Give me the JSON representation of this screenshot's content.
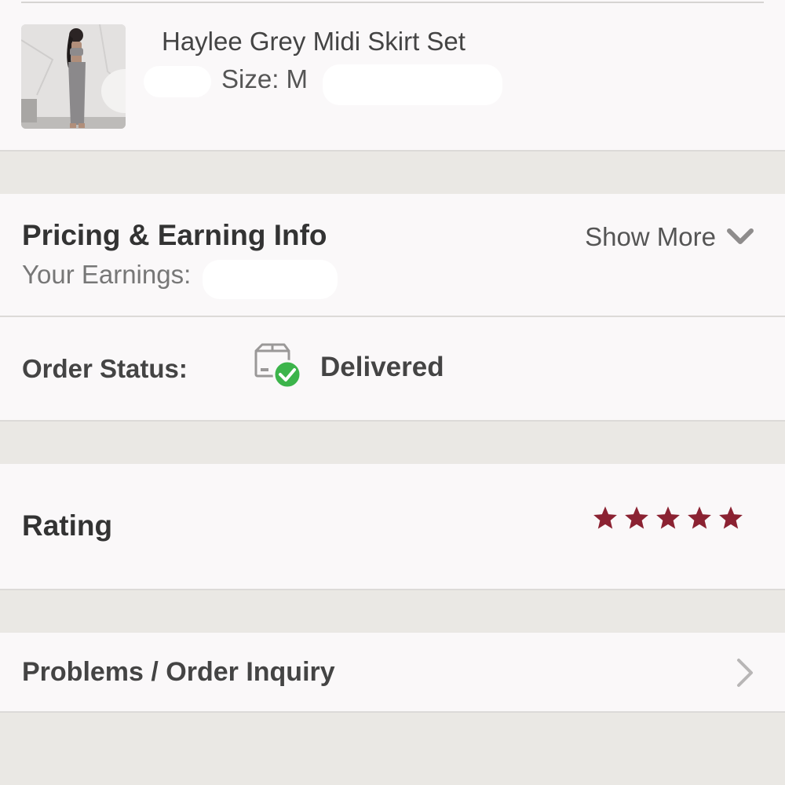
{
  "product": {
    "name": "Haylee Grey Midi Skirt Set",
    "size": "Size: M",
    "thumbnail": "product-photo"
  },
  "pricing": {
    "title": "Pricing & Earning Info",
    "show_more": "Show More",
    "earnings_label": "Your Earnings:"
  },
  "status": {
    "label": "Order Status:",
    "value": "Delivered",
    "icon": "package-delivered-icon",
    "check_color": "#3cb44b"
  },
  "rating": {
    "label": "Rating",
    "stars": 5,
    "max_stars": 5,
    "star_color": "#8b2232"
  },
  "problems": {
    "label": "Problems / Order Inquiry"
  },
  "colors": {
    "background": "#eae8e4",
    "card": "#faf8f9",
    "text": "#333333"
  }
}
